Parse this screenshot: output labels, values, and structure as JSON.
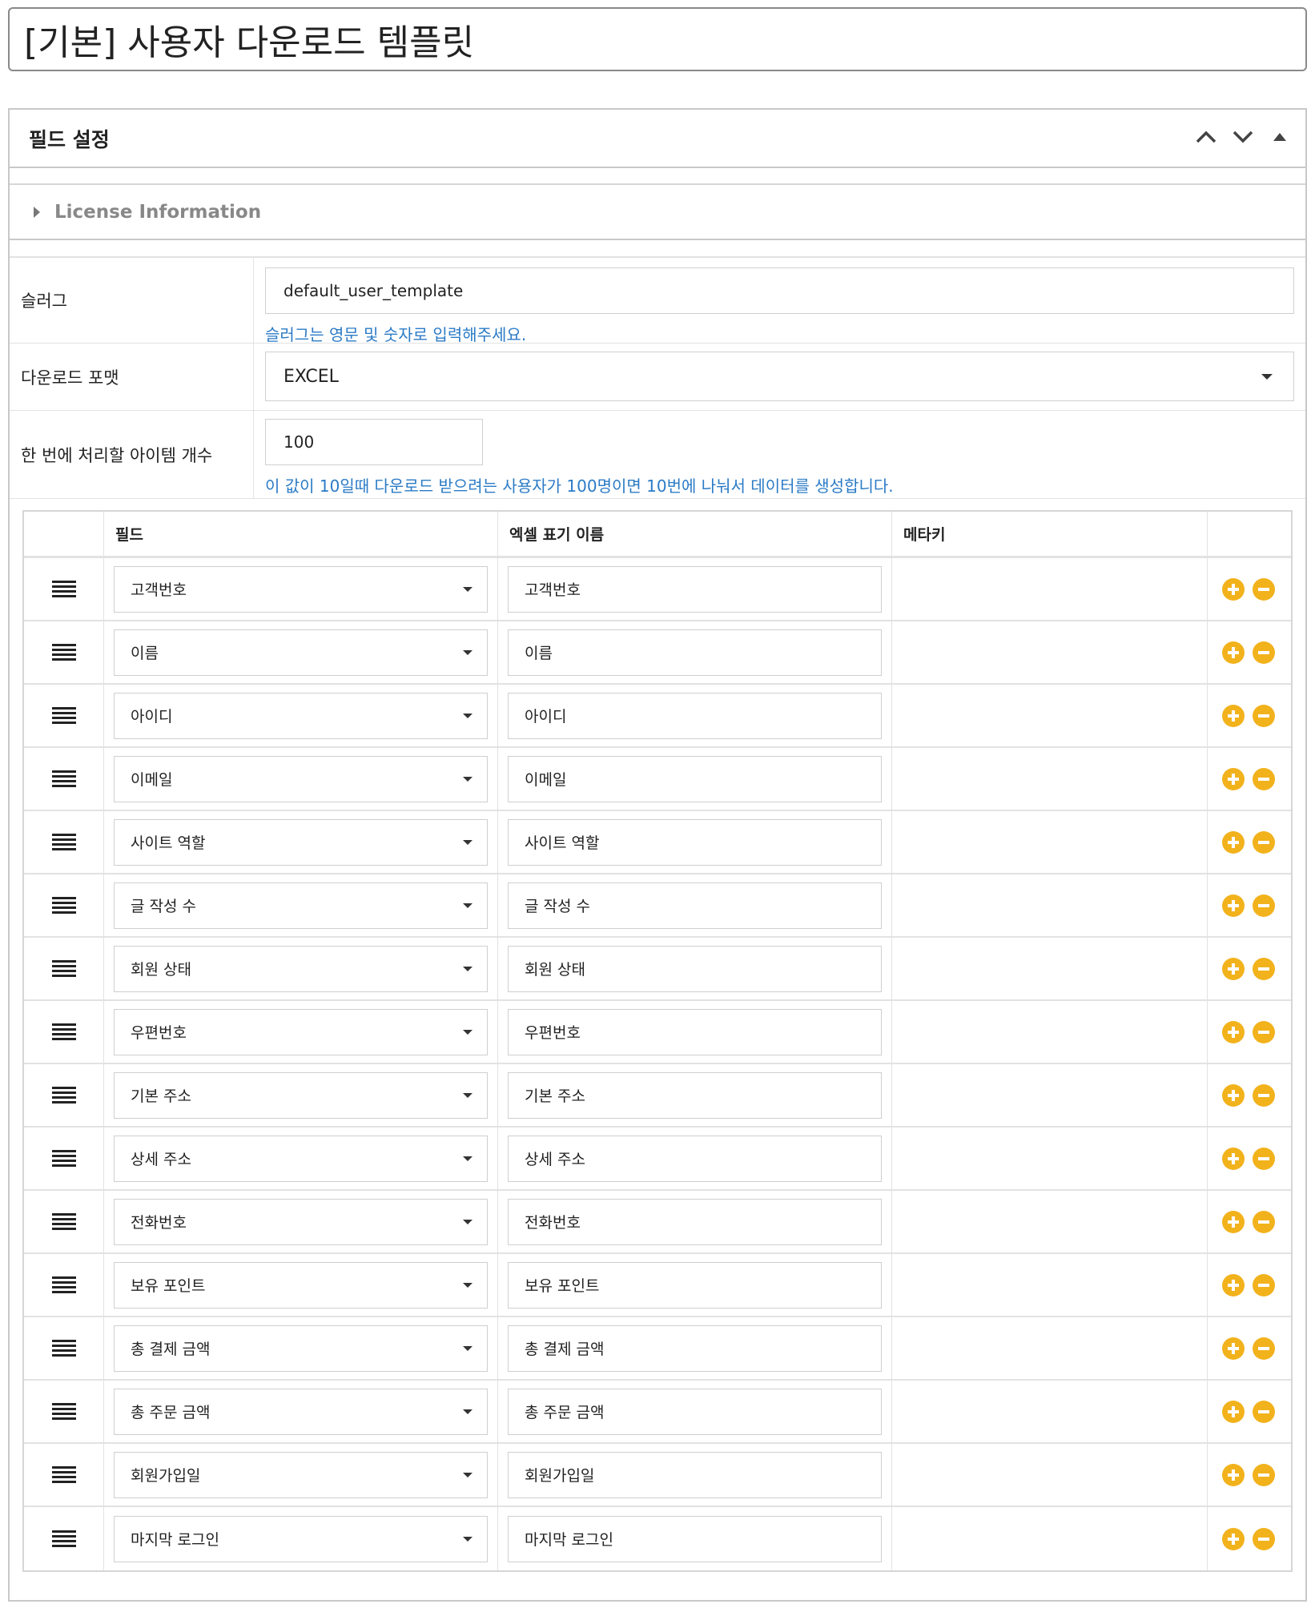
{
  "page": {
    "title": "[기본] 사용자 다운로드 템플릿"
  },
  "panel": {
    "title": "필드 설정",
    "license_label": "License Information"
  },
  "form": {
    "slug_label": "슬러그",
    "slug_value": "default_user_template",
    "slug_help": "슬러그는 영문 및 숫자로 입력해주세요.",
    "format_label": "다운로드 포맷",
    "format_value": "EXCEL",
    "batch_label": "한 번에 처리할 아이템 개수",
    "batch_value": "100",
    "batch_help": "이 값이 10일때 다운로드 받으려는 사용자가 100명이면 10번에 나눠서 데이터를 생성합니다."
  },
  "grid": {
    "headers": [
      "필드",
      "엑셀 표기 이름",
      "메타키"
    ],
    "rows": [
      {
        "field": "고객번호",
        "excel": "고객번호"
      },
      {
        "field": "이름",
        "excel": "이름"
      },
      {
        "field": "아이디",
        "excel": "아이디"
      },
      {
        "field": "이메일",
        "excel": "이메일"
      },
      {
        "field": "사이트 역할",
        "excel": "사이트 역할"
      },
      {
        "field": "글 작성 수",
        "excel": "글 작성 수"
      },
      {
        "field": "회원 상태",
        "excel": "회원 상태"
      },
      {
        "field": "우편번호",
        "excel": "우편번호"
      },
      {
        "field": "기본 주소",
        "excel": "기본 주소"
      },
      {
        "field": "상세 주소",
        "excel": "상세 주소"
      },
      {
        "field": "전화번호",
        "excel": "전화번호"
      },
      {
        "field": "보유 포인트",
        "excel": "보유 포인트"
      },
      {
        "field": "총 결제 금액",
        "excel": "총 결제 금액"
      },
      {
        "field": "총 주문 금액",
        "excel": "총 주문 금액"
      },
      {
        "field": "회원가입일",
        "excel": "회원가입일"
      },
      {
        "field": "마지막 로그인",
        "excel": "마지막 로그인"
      }
    ]
  },
  "colors": {
    "help_text": "#2b7bc6",
    "action_button": "#f2b21c"
  },
  "icons": {
    "row_handle": "drag-handle-icon",
    "add": "plus-circle-icon",
    "remove": "minus-circle-icon"
  }
}
